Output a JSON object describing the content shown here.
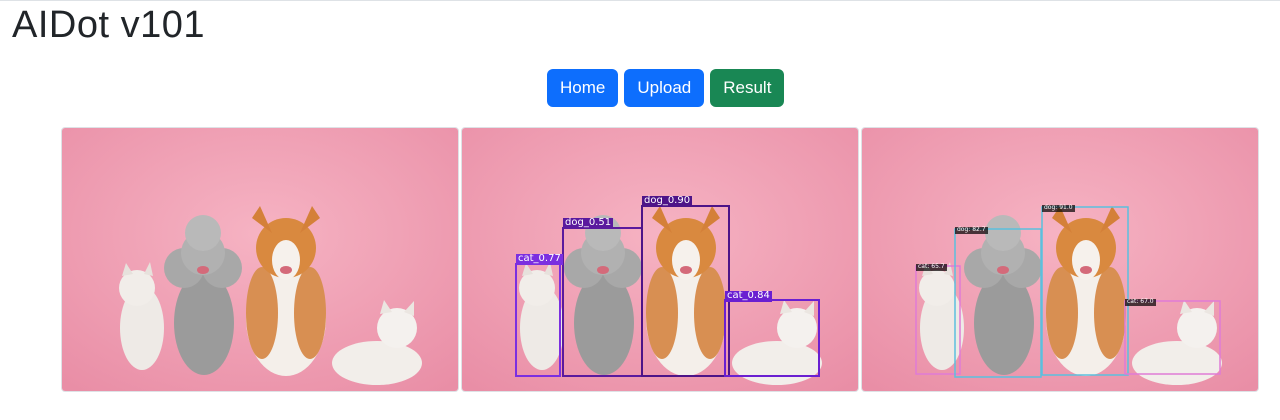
{
  "page": {
    "title": "AIDot v101"
  },
  "nav": {
    "home_label": "Home",
    "upload_label": "Upload",
    "result_label": "Result"
  },
  "colors": {
    "primary": "#0d6efd",
    "success": "#198754",
    "background_pink": "#f2a4b6",
    "yolo_box": "#6a1fd1",
    "alt_box_cyan": "#5bc0de",
    "alt_box_pink": "#e07bd6"
  },
  "panels": [
    {
      "name": "original-image",
      "detections": []
    },
    {
      "name": "yolo-result-image",
      "detections": [
        {
          "label": "cat_0.77",
          "class": "cat",
          "score": 0.77
        },
        {
          "label": "dog_0.51",
          "class": "dog",
          "score": 0.51
        },
        {
          "label": "dog_0.90",
          "class": "dog",
          "score": 0.9
        },
        {
          "label": "cat_0.84",
          "class": "cat",
          "score": 0.84
        }
      ]
    },
    {
      "name": "alt-result-image",
      "detections": [
        {
          "label": "cat: 65.7",
          "class": "cat",
          "score": 65.7
        },
        {
          "label": "dog: 82.7",
          "class": "dog",
          "score": 82.7
        },
        {
          "label": "dog: 91.0",
          "class": "dog",
          "score": 91.0
        },
        {
          "label": "cat: 67.0",
          "class": "cat",
          "score": 67.0
        }
      ]
    }
  ]
}
